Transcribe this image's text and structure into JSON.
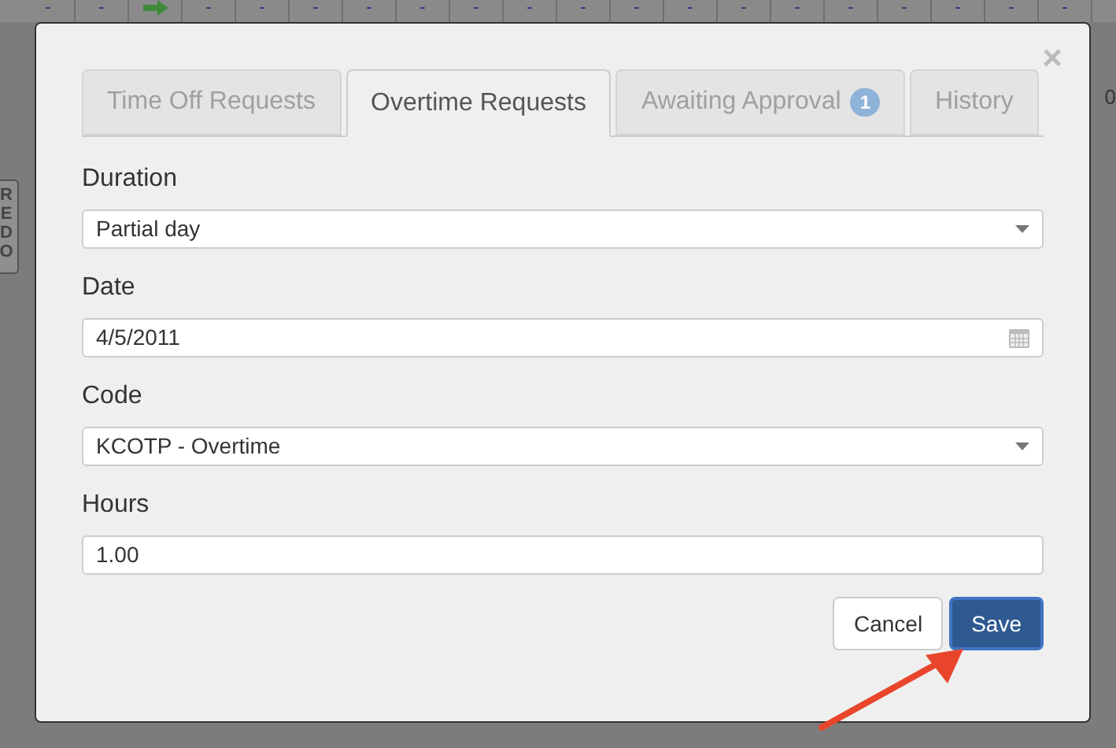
{
  "background": {
    "top_cells": [
      {
        "kind": "dash",
        "text": "-"
      },
      {
        "kind": "dash",
        "text": "-"
      },
      {
        "kind": "arrow"
      },
      {
        "kind": "dash",
        "text": "-"
      },
      {
        "kind": "dash",
        "text": "-"
      },
      {
        "kind": "dash",
        "text": "-"
      },
      {
        "kind": "dash",
        "text": "-"
      },
      {
        "kind": "dash",
        "text": "-"
      },
      {
        "kind": "dash",
        "text": "-"
      },
      {
        "kind": "dash",
        "text": "-"
      },
      {
        "kind": "dash",
        "text": "-"
      },
      {
        "kind": "dash",
        "text": "-"
      },
      {
        "kind": "dash",
        "text": "-"
      },
      {
        "kind": "dash",
        "text": "-"
      },
      {
        "kind": "dash",
        "text": "-"
      },
      {
        "kind": "dash",
        "text": "-"
      },
      {
        "kind": "dash",
        "text": "-"
      },
      {
        "kind": "dash",
        "text": "-"
      },
      {
        "kind": "dash",
        "text": "-"
      },
      {
        "kind": "dash",
        "text": "-"
      }
    ],
    "side_button": "REDO",
    "edge_text": "0"
  },
  "dialog": {
    "close": "×",
    "tabs": [
      {
        "label": "Time Off Requests",
        "selected": false
      },
      {
        "label": "Overtime Requests",
        "selected": true
      },
      {
        "label": "Awaiting Approval",
        "badge": "1",
        "selected": false
      },
      {
        "label": "History",
        "selected": false
      }
    ],
    "fields": [
      {
        "label": "Duration",
        "kind": "select",
        "value": "Partial day"
      },
      {
        "label": "Date",
        "kind": "date",
        "value": "4/5/2011"
      },
      {
        "label": "Code",
        "kind": "select",
        "value": "KCOTP - Overtime"
      },
      {
        "label": "Hours",
        "kind": "text",
        "value": "1.00"
      }
    ],
    "buttons": [
      {
        "label": "Cancel",
        "kind": "default"
      },
      {
        "label": "Save",
        "kind": "primary"
      }
    ]
  }
}
